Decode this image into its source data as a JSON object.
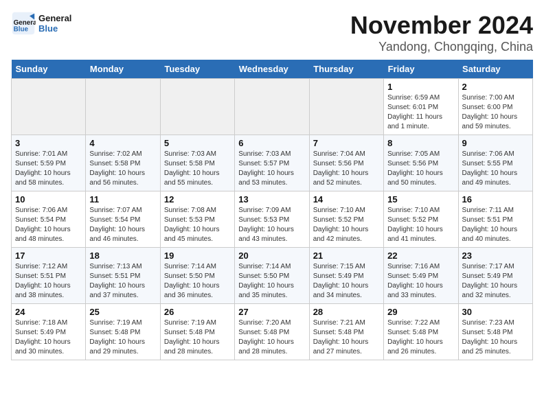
{
  "logo": {
    "line1": "General",
    "line2": "Blue"
  },
  "title": "November 2024",
  "location": "Yandong, Chongqing, China",
  "days_of_week": [
    "Sunday",
    "Monday",
    "Tuesday",
    "Wednesday",
    "Thursday",
    "Friday",
    "Saturday"
  ],
  "weeks": [
    {
      "days": [
        {
          "num": "",
          "info": ""
        },
        {
          "num": "",
          "info": ""
        },
        {
          "num": "",
          "info": ""
        },
        {
          "num": "",
          "info": ""
        },
        {
          "num": "",
          "info": ""
        },
        {
          "num": "1",
          "info": "Sunrise: 6:59 AM\nSunset: 6:01 PM\nDaylight: 11 hours and 1 minute."
        },
        {
          "num": "2",
          "info": "Sunrise: 7:00 AM\nSunset: 6:00 PM\nDaylight: 10 hours and 59 minutes."
        }
      ]
    },
    {
      "days": [
        {
          "num": "3",
          "info": "Sunrise: 7:01 AM\nSunset: 5:59 PM\nDaylight: 10 hours and 58 minutes."
        },
        {
          "num": "4",
          "info": "Sunrise: 7:02 AM\nSunset: 5:58 PM\nDaylight: 10 hours and 56 minutes."
        },
        {
          "num": "5",
          "info": "Sunrise: 7:03 AM\nSunset: 5:58 PM\nDaylight: 10 hours and 55 minutes."
        },
        {
          "num": "6",
          "info": "Sunrise: 7:03 AM\nSunset: 5:57 PM\nDaylight: 10 hours and 53 minutes."
        },
        {
          "num": "7",
          "info": "Sunrise: 7:04 AM\nSunset: 5:56 PM\nDaylight: 10 hours and 52 minutes."
        },
        {
          "num": "8",
          "info": "Sunrise: 7:05 AM\nSunset: 5:56 PM\nDaylight: 10 hours and 50 minutes."
        },
        {
          "num": "9",
          "info": "Sunrise: 7:06 AM\nSunset: 5:55 PM\nDaylight: 10 hours and 49 minutes."
        }
      ]
    },
    {
      "days": [
        {
          "num": "10",
          "info": "Sunrise: 7:06 AM\nSunset: 5:54 PM\nDaylight: 10 hours and 48 minutes."
        },
        {
          "num": "11",
          "info": "Sunrise: 7:07 AM\nSunset: 5:54 PM\nDaylight: 10 hours and 46 minutes."
        },
        {
          "num": "12",
          "info": "Sunrise: 7:08 AM\nSunset: 5:53 PM\nDaylight: 10 hours and 45 minutes."
        },
        {
          "num": "13",
          "info": "Sunrise: 7:09 AM\nSunset: 5:53 PM\nDaylight: 10 hours and 43 minutes."
        },
        {
          "num": "14",
          "info": "Sunrise: 7:10 AM\nSunset: 5:52 PM\nDaylight: 10 hours and 42 minutes."
        },
        {
          "num": "15",
          "info": "Sunrise: 7:10 AM\nSunset: 5:52 PM\nDaylight: 10 hours and 41 minutes."
        },
        {
          "num": "16",
          "info": "Sunrise: 7:11 AM\nSunset: 5:51 PM\nDaylight: 10 hours and 40 minutes."
        }
      ]
    },
    {
      "days": [
        {
          "num": "17",
          "info": "Sunrise: 7:12 AM\nSunset: 5:51 PM\nDaylight: 10 hours and 38 minutes."
        },
        {
          "num": "18",
          "info": "Sunrise: 7:13 AM\nSunset: 5:51 PM\nDaylight: 10 hours and 37 minutes."
        },
        {
          "num": "19",
          "info": "Sunrise: 7:14 AM\nSunset: 5:50 PM\nDaylight: 10 hours and 36 minutes."
        },
        {
          "num": "20",
          "info": "Sunrise: 7:14 AM\nSunset: 5:50 PM\nDaylight: 10 hours and 35 minutes."
        },
        {
          "num": "21",
          "info": "Sunrise: 7:15 AM\nSunset: 5:49 PM\nDaylight: 10 hours and 34 minutes."
        },
        {
          "num": "22",
          "info": "Sunrise: 7:16 AM\nSunset: 5:49 PM\nDaylight: 10 hours and 33 minutes."
        },
        {
          "num": "23",
          "info": "Sunrise: 7:17 AM\nSunset: 5:49 PM\nDaylight: 10 hours and 32 minutes."
        }
      ]
    },
    {
      "days": [
        {
          "num": "24",
          "info": "Sunrise: 7:18 AM\nSunset: 5:49 PM\nDaylight: 10 hours and 30 minutes."
        },
        {
          "num": "25",
          "info": "Sunrise: 7:19 AM\nSunset: 5:48 PM\nDaylight: 10 hours and 29 minutes."
        },
        {
          "num": "26",
          "info": "Sunrise: 7:19 AM\nSunset: 5:48 PM\nDaylight: 10 hours and 28 minutes."
        },
        {
          "num": "27",
          "info": "Sunrise: 7:20 AM\nSunset: 5:48 PM\nDaylight: 10 hours and 28 minutes."
        },
        {
          "num": "28",
          "info": "Sunrise: 7:21 AM\nSunset: 5:48 PM\nDaylight: 10 hours and 27 minutes."
        },
        {
          "num": "29",
          "info": "Sunrise: 7:22 AM\nSunset: 5:48 PM\nDaylight: 10 hours and 26 minutes."
        },
        {
          "num": "30",
          "info": "Sunrise: 7:23 AM\nSunset: 5:48 PM\nDaylight: 10 hours and 25 minutes."
        }
      ]
    }
  ]
}
